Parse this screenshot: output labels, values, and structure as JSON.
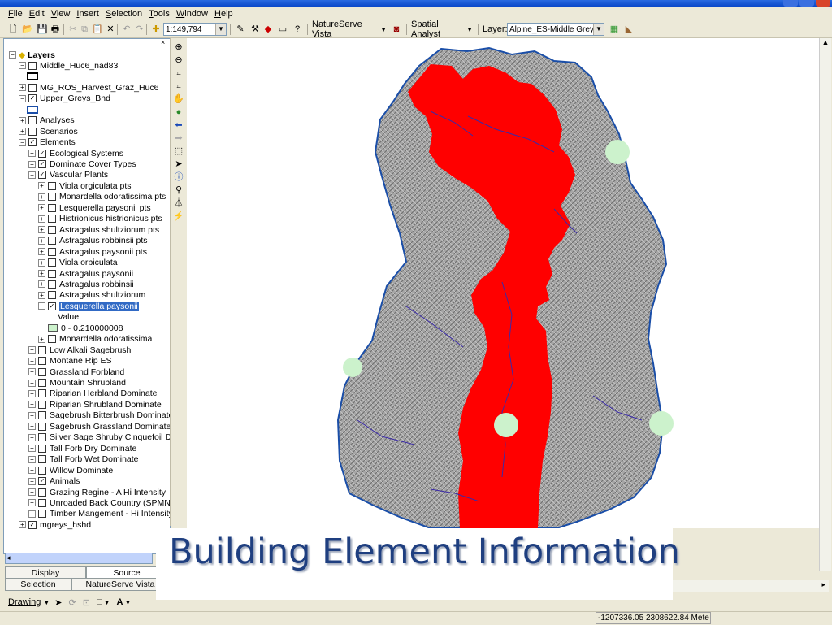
{
  "menu": [
    "File",
    "Edit",
    "View",
    "Insert",
    "Selection",
    "Tools",
    "Window",
    "Help"
  ],
  "toolbar": {
    "scale": "1:149,794",
    "naturserve": "NatureServe Vista",
    "spatial_analyst": "Spatial Analyst",
    "layer_label": "Layer:",
    "layer_value": "Alpine_ES-Middle Greys I"
  },
  "toc": {
    "root": "Layers",
    "layers": [
      {
        "label": "Middle_Huc6_nad83",
        "checked": false,
        "indent": 1,
        "exp": "minus"
      },
      {
        "label": "MG_ROS_Harvest_Graz_Huc6",
        "checked": false,
        "indent": 1,
        "exp": "plus"
      },
      {
        "label": "Upper_Greys_Bnd",
        "checked": true,
        "indent": 1,
        "exp": "minus"
      },
      {
        "label": "Analyses",
        "checked": false,
        "indent": 1,
        "exp": "plus"
      },
      {
        "label": "Scenarios",
        "checked": false,
        "indent": 1,
        "exp": "plus"
      },
      {
        "label": "Elements",
        "checked": true,
        "indent": 1,
        "exp": "minus"
      },
      {
        "label": "Ecological Systems",
        "checked": true,
        "indent": 2,
        "exp": "plus"
      },
      {
        "label": "Dominate Cover Types",
        "checked": true,
        "indent": 2,
        "exp": "plus"
      },
      {
        "label": "Vascular Plants",
        "checked": true,
        "indent": 2,
        "exp": "minus"
      },
      {
        "label": "Viola orgiculata pts",
        "checked": false,
        "indent": 3,
        "exp": "plus"
      },
      {
        "label": "Monardella odoratissima pts",
        "checked": false,
        "indent": 3,
        "exp": "plus"
      },
      {
        "label": "Lesquerella paysonii pts",
        "checked": false,
        "indent": 3,
        "exp": "plus"
      },
      {
        "label": "Histrionicus histrionicus pts",
        "checked": false,
        "indent": 3,
        "exp": "plus"
      },
      {
        "label": "Astragalus shultziorum pts",
        "checked": false,
        "indent": 3,
        "exp": "plus"
      },
      {
        "label": "Astragalus robbinsii pts",
        "checked": false,
        "indent": 3,
        "exp": "plus"
      },
      {
        "label": "Astragalus paysonii pts",
        "checked": false,
        "indent": 3,
        "exp": "plus"
      },
      {
        "label": "Viola orbiculata",
        "checked": false,
        "indent": 3,
        "exp": "plus"
      },
      {
        "label": "Astragalus paysonii",
        "checked": false,
        "indent": 3,
        "exp": "plus"
      },
      {
        "label": "Astragalus robbinsii",
        "checked": false,
        "indent": 3,
        "exp": "plus"
      },
      {
        "label": "Astragalus shultziorum",
        "checked": false,
        "indent": 3,
        "exp": "plus"
      },
      {
        "label": "Lesquerella paysonii",
        "checked": true,
        "indent": 3,
        "exp": "minus",
        "selected": true
      },
      {
        "label": "Monardella odoratissima",
        "checked": false,
        "indent": 3,
        "exp": "plus"
      },
      {
        "label": "Low Alkali Sagebrush",
        "checked": false,
        "indent": 2,
        "exp": "plus"
      },
      {
        "label": "Montane Rip ES",
        "checked": false,
        "indent": 2,
        "exp": "plus"
      },
      {
        "label": "Grassland Forbland",
        "checked": false,
        "indent": 2,
        "exp": "plus"
      },
      {
        "label": "Mountain Shrubland",
        "checked": false,
        "indent": 2,
        "exp": "plus"
      },
      {
        "label": "Riparian Herbland Dominate",
        "checked": false,
        "indent": 2,
        "exp": "plus"
      },
      {
        "label": "Riparian Shrubland Dominate",
        "checked": false,
        "indent": 2,
        "exp": "plus"
      },
      {
        "label": "Sagebrush Bitterbrush Dominate",
        "checked": false,
        "indent": 2,
        "exp": "plus"
      },
      {
        "label": "Sagebrush Grassland Dominate",
        "checked": false,
        "indent": 2,
        "exp": "plus"
      },
      {
        "label": "Silver Sage Shruby Cinquefoil Dom",
        "checked": false,
        "indent": 2,
        "exp": "plus"
      },
      {
        "label": "Tall Forb Dry Dominate",
        "checked": false,
        "indent": 2,
        "exp": "plus"
      },
      {
        "label": "Tall Forb Wet Dominate",
        "checked": false,
        "indent": 2,
        "exp": "plus"
      },
      {
        "label": "Willow Dominate",
        "checked": false,
        "indent": 2,
        "exp": "plus"
      },
      {
        "label": "Animals",
        "checked": true,
        "indent": 2,
        "exp": "plus"
      },
      {
        "label": "Grazing Regine - A Hi Intensity",
        "checked": false,
        "indent": 2,
        "exp": "plus"
      },
      {
        "label": "Unroaded Back Country (SPMN)",
        "checked": false,
        "indent": 2,
        "exp": "plus"
      },
      {
        "label": "Timber Mangement - Hi Intensity",
        "checked": false,
        "indent": 2,
        "exp": "plus"
      },
      {
        "label": "mgreys_hshd",
        "checked": true,
        "indent": 1,
        "exp": "plus"
      }
    ],
    "legend_value": "Value",
    "legend_range": "0 - 0.210000008"
  },
  "tabs": {
    "display": "Display",
    "source": "Source",
    "selection": "Selection",
    "naturserve": "NatureServe Vista"
  },
  "drawing": {
    "label": "Drawing"
  },
  "status": {
    "coords": "-1207336.05  2308622.84 Mete"
  },
  "caption": "Building Element Information",
  "colors": {
    "habitat": "#ff0000",
    "points": "#ccf2cc",
    "boundary": "#1a4ea8",
    "hillshade": "#9a9a9a",
    "caption": "#1f3f80"
  }
}
